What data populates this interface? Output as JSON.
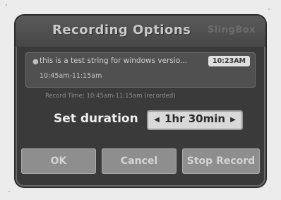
{
  "dialog": {
    "title": "Recording Options",
    "logo_text": "SlingBox",
    "info": {
      "program_title": "this is a test string for windows versio...",
      "program_time": "10:45am-11:15am",
      "clock": "10:23AM"
    },
    "record_time": "Record Time: 10:45am-11:15am (recorded)",
    "duration": {
      "label": "Set duration",
      "value": "1hr 30min"
    },
    "buttons": {
      "ok": "OK",
      "cancel": "Cancel",
      "stop_record": "Stop Record"
    }
  },
  "icons": {
    "left_arrow": "arrow-left-icon",
    "right_arrow": "arrow-right-icon",
    "bullet": "bullet-icon"
  },
  "colors": {
    "dialog_bg": "#3a3a3a",
    "titlebar_bg": "#4e4e4e",
    "panel_bg": "#505050",
    "button_bg": "#8e8e8e",
    "spinner_bg": "#d9d9d9"
  }
}
